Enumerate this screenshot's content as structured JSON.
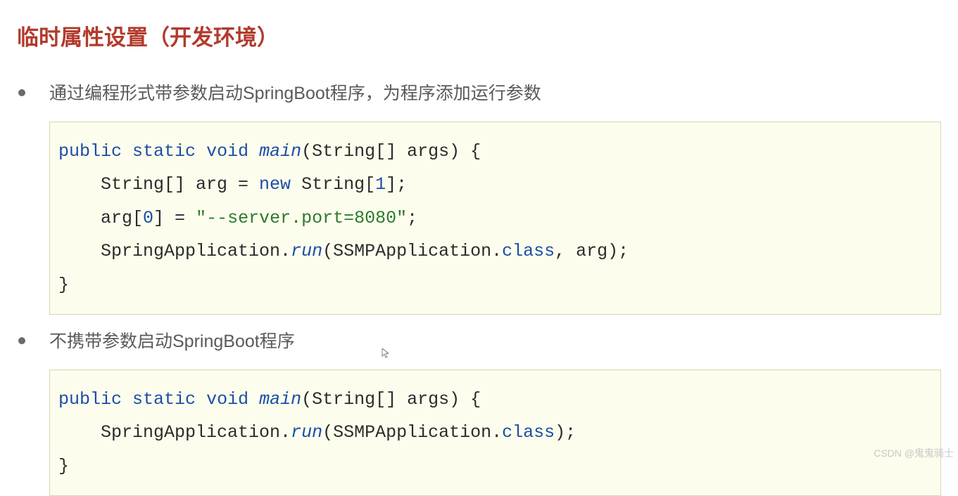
{
  "title": "临时属性设置（开发环境）",
  "bullets": [
    {
      "text": "通过编程形式带参数启动SpringBoot程序，为程序添加运行参数"
    },
    {
      "text": "不携带参数启动SpringBoot程序"
    }
  ],
  "code1": {
    "kw_public": "public",
    "kw_static": "static",
    "kw_void": "void",
    "fn_main": "main",
    "sig_open": "(String[] args) {",
    "line2a": "    String[] arg = ",
    "kw_new": "new",
    "line2b": " String[",
    "num_1": "1",
    "line2c": "];",
    "line3a": "    arg[",
    "num_0": "0",
    "line3b": "] = ",
    "str_port": "\"--server.port=8080\"",
    "line3c": ";",
    "line4a": "    SpringApplication.",
    "fn_run": "run",
    "line4b": "(SSMPApplication.",
    "kw_class": "class",
    "line4c": ", arg);",
    "close": "}"
  },
  "code2": {
    "kw_public": "public",
    "kw_static": "static",
    "kw_void": "void",
    "fn_main": "main",
    "sig_open": "(String[] args) {",
    "line2a": "    SpringApplication.",
    "fn_run": "run",
    "line2b": "(SSMPApplication.",
    "kw_class": "class",
    "line2c": ");",
    "close": "}"
  },
  "watermark": "CSDN @鬼鬼骑士"
}
